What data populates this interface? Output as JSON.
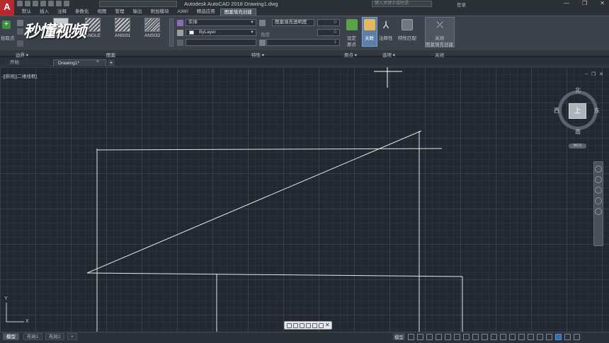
{
  "app": {
    "logo_letter": "A",
    "title": "Autodesk AutoCAD 2018    Drawing1.dwg",
    "search_placeholder": "键入关键字或短语",
    "signin": "登录",
    "win_min": "—",
    "win_max": "❐",
    "win_close": "✕"
  },
  "ribbon_tabs": [
    {
      "label": "默认"
    },
    {
      "label": "插入"
    },
    {
      "label": "注释"
    },
    {
      "label": "参数化"
    },
    {
      "label": "视图"
    },
    {
      "label": "管理"
    },
    {
      "label": "输出"
    },
    {
      "label": "附加模块"
    },
    {
      "label": "A360"
    },
    {
      "label": "精选应用"
    },
    {
      "label": "图案填充创建"
    }
  ],
  "boundary": {
    "pick_label": "拾取点",
    "panel": "边界 ▾"
  },
  "pattern": {
    "items": [
      "SOLID",
      "ANGLE",
      "ANSI31",
      "ANSI32"
    ],
    "panel": "图案"
  },
  "properties": {
    "type_value": "实体",
    "color_value": "ByLayer",
    "transparency_label": "图案填充透明度",
    "transparency_value": "0",
    "angle_label": "角度",
    "angle_value": "0",
    "scale_value": "1",
    "panel": "特性 ▾"
  },
  "origin": {
    "set_label": "设定",
    "set_label2": "原点",
    "panel": "原点 ▾"
  },
  "options": {
    "associative": "关联",
    "annotative": "注释性",
    "match_props": "特性匹配",
    "panel": "选项 ▾"
  },
  "close": {
    "label1": "关闭",
    "label2": "图案填充创建",
    "panel": "关闭"
  },
  "watermark": "秒懂视频",
  "file_tabs": {
    "start": "开始",
    "drawing": "Drawing1*",
    "close": "×",
    "new": "+"
  },
  "viewport": {
    "label": "-][俯视][二维线框]",
    "min": "–",
    "restore": "❐",
    "close": "✕"
  },
  "viewcube": {
    "top": "上",
    "north": "北",
    "south": "南",
    "east": "东",
    "west": "西",
    "wcs": "WCS"
  },
  "ucs": {
    "x": "X",
    "y": "Y"
  },
  "layout_tabs": [
    "模型",
    "布局1",
    "布局2"
  ],
  "layout_add": "+",
  "status": {
    "model": "模型"
  },
  "float_close": "✕",
  "colors": {
    "canvas_bg": "#212830",
    "line": "#e6e8ec",
    "ribbon_bg": "#3c424b",
    "accent_blue": "#5b7fa9"
  },
  "icons": [
    "add-icon",
    "hatch-pattern-icon",
    "color-swatch-icon",
    "crosshair-cursor-icon",
    "close-icon",
    "plus-icon",
    "compass-icon"
  ]
}
